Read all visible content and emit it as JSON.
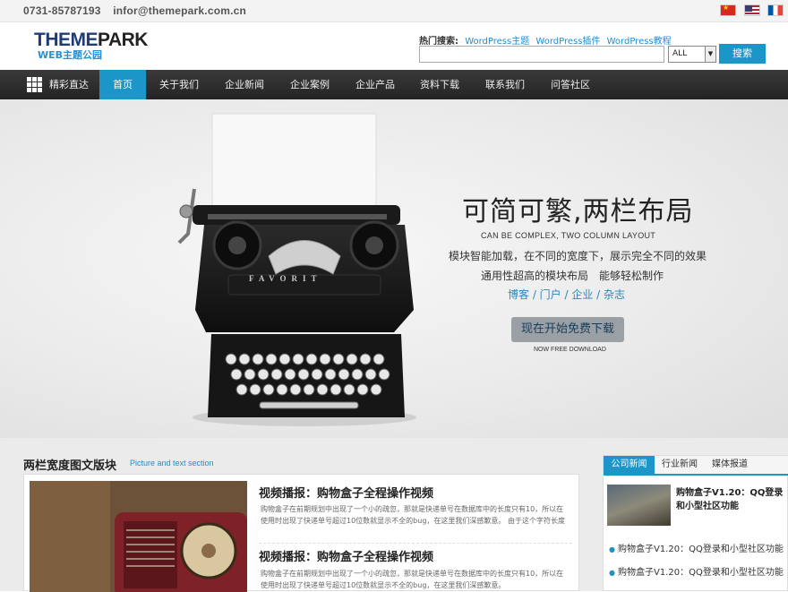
{
  "topbar": {
    "phone": "0731-85787193",
    "email": "infor@themepark.com.cn",
    "flags": [
      "china-flag-icon",
      "usa-flag-icon",
      "france-flag-icon"
    ]
  },
  "header": {
    "logo_main_a": "THEME",
    "logo_main_b": "PARK",
    "logo_sub": "WEB主题公园",
    "hot_label": "热门搜索:",
    "hot_links": [
      "WordPress主题",
      "WordPress插件",
      "WordPress教程"
    ],
    "search_value": "",
    "select_value": "ALL",
    "search_button": "搜索"
  },
  "nav": {
    "menu_label": "精彩直达",
    "items": [
      "首页",
      "关于我们",
      "企业新闻",
      "企业案例",
      "企业产品",
      "资料下载",
      "联系我们",
      "问答社区"
    ],
    "active_index": 0
  },
  "banner": {
    "title": "可简可繁,两栏布局",
    "subtitle_en": "CAN BE COMPLEX, TWO COLUMN LAYOUT",
    "line1": "模块智能加载，在不同的宽度下，展示完全不同的效果",
    "line2": "通用性超高的模块布局　能够轻松制作",
    "line3": "博客 / 门户 / 企业 / 杂志",
    "button": "现在开始免费下载",
    "button_sub": "NOW FREE DOWNLOAD",
    "typewriter_brand": "FAVORIT"
  },
  "section": {
    "title": "两栏宽度图文版块",
    "subtitle": "Picture and text section",
    "posts": [
      {
        "title": "视频播报：购物盒子全程操作视频",
        "body": "购物盒子在前期规划中出现了一个小的疏忽，那就是快递单号在数据库中的长度只有10，所以在使用时出现了快递单号超过10位数就显示不全的bug，在这里我们深感歉意。 由于这个字符长度"
      },
      {
        "title": "视频播报：购物盒子全程操作视频",
        "body": "购物盒子在前期规划中出现了一个小的疏忽，那就是快递单号在数据库中的长度只有10，所以在使用时出现了快递单号超过10位数就显示不全的bug，在这里我们深感歉意。"
      }
    ]
  },
  "sidebar": {
    "tabs": [
      "公司新闻",
      "行业新闻",
      "媒体报道"
    ],
    "active_tab": 0,
    "featured": "购物盒子V1.20：QQ登录和小型社区功能",
    "items": [
      "购物盒子V1.20：QQ登录和小型社区功能",
      "购物盒子V1.20：QQ登录和小型社区功能"
    ]
  },
  "colors": {
    "accent": "#1c95c8",
    "nav_bg": "#2b2b2b",
    "logo": "#1f3d74"
  }
}
